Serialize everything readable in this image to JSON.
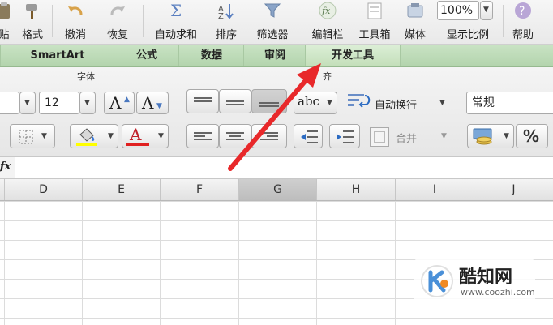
{
  "toolbar": {
    "paste_label": "贴",
    "format_label": "格式",
    "undo_label": "撤消",
    "redo_label": "恢复",
    "autosum_label": "自动求和",
    "sort_label": "排序",
    "filter_label": "筛选器",
    "formula_bar_label": "编辑栏",
    "toolbox_label": "工具箱",
    "media_label": "媒体",
    "zoom_label": "显示比例",
    "zoom_value": "100%",
    "help_label": "帮助"
  },
  "tabs": [
    "SmartArt",
    "公式",
    "数据",
    "审阅",
    "开发工具"
  ],
  "ribbon": {
    "font_group_title": "字体",
    "align_group_title_partial": "齐",
    "font_size": "12",
    "increase_font_label": "A",
    "decrease_font_label": "A",
    "font_color_label": "A",
    "orientation_label": "abc",
    "wrap_text_label": "自动换行",
    "merge_label": "合并",
    "number_format": "常规",
    "percent_label": "%"
  },
  "formula_bar": {
    "fx_label": "fx",
    "value": ""
  },
  "columns": [
    "D",
    "E",
    "F",
    "G",
    "H",
    "I",
    "J"
  ],
  "selected_column": "G",
  "watermark": {
    "title": "酷知网",
    "url": "www.coozhi.com"
  },
  "colors": {
    "tab_bg": "#b9d8b2",
    "highlight_yellow": "#ffff00",
    "font_red": "#e02020",
    "arrow_red": "#e8282a"
  }
}
